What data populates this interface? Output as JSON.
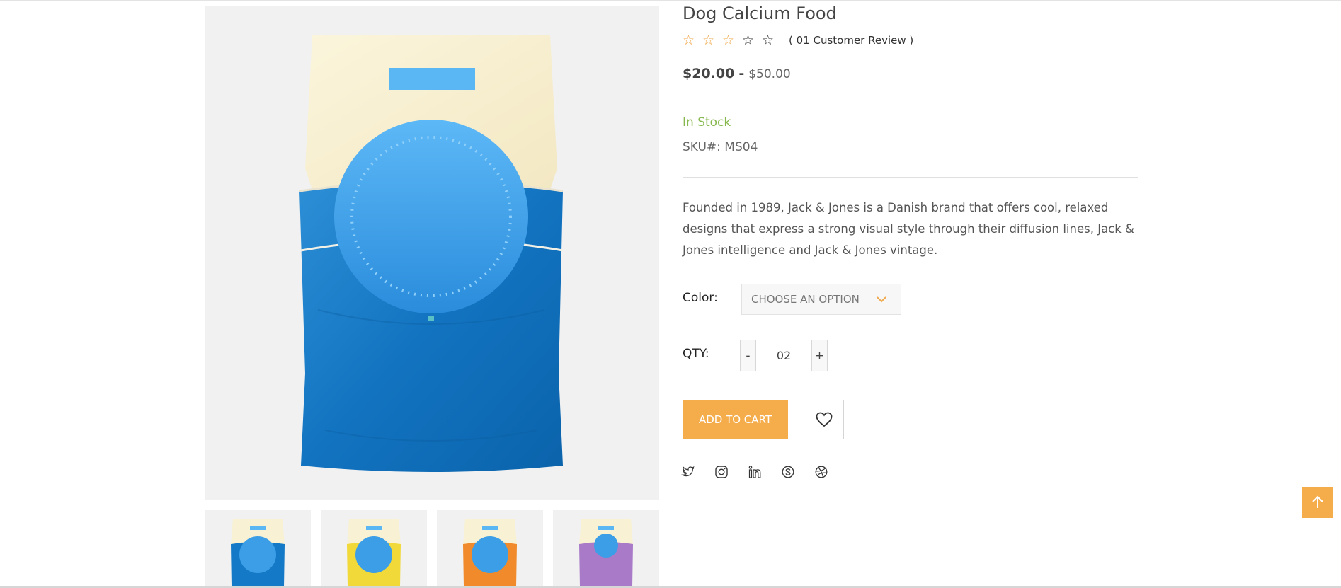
{
  "product": {
    "title": "Dog Calcium Food",
    "rating": 3,
    "rating_max": 5,
    "review_text": "( 01 Customer Review )",
    "price_current": "$20.00",
    "price_separator": "-",
    "price_old": "$50.00",
    "stock_status": "In Stock",
    "sku": "SKU#: MS04",
    "description": "Founded in 1989, Jack & Jones is a Danish brand that offers cool, relaxed designs that express a strong visual style through their diffusion lines, Jack & Jones intelligence and Jack & Jones vintage."
  },
  "options": {
    "color_label": "Color:",
    "color_placeholder": "CHOOSE AN OPTION",
    "qty_label": "QTY:",
    "qty_minus": "-",
    "qty_value": "02",
    "qty_plus": "+"
  },
  "actions": {
    "add_to_cart": "ADD TO CART"
  },
  "gallery": {
    "thumbnails": [
      {
        "color": "blue"
      },
      {
        "color": "yellow"
      },
      {
        "color": "orange"
      },
      {
        "color": "purple"
      }
    ]
  },
  "social_icons": [
    "twitter-icon",
    "instagram-icon",
    "linkedin-icon",
    "skype-icon",
    "dribbble-icon"
  ],
  "colors": {
    "accent": "#f5ad4c",
    "stock": "#86b84e",
    "bag_blue": "#1479c6",
    "bag_cream": "#f8f1d3"
  }
}
